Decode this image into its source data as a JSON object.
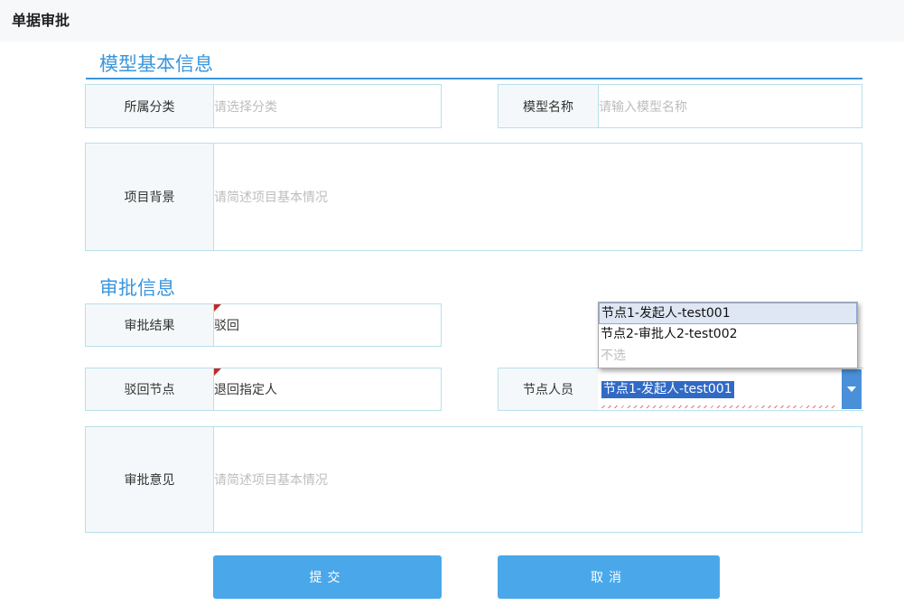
{
  "header": {
    "title": "单据审批"
  },
  "section_model": {
    "title": "模型基本信息",
    "category": {
      "label": "所属分类",
      "placeholder": "请选择分类"
    },
    "model_name": {
      "label": "模型名称",
      "placeholder": "请输入模型名称"
    },
    "background": {
      "label": "项目背景",
      "placeholder": "请简述项目基本情况"
    }
  },
  "section_approval": {
    "title": "审批信息",
    "result": {
      "label": "审批结果",
      "value": "驳回"
    },
    "reject_node": {
      "label": "驳回节点",
      "value": "退回指定人"
    },
    "node_person": {
      "label": "节点人员",
      "selected": "节点1-发起人-test001",
      "options": [
        "节点1-发起人-test001",
        "节点2-审批人2-test002",
        "不选"
      ]
    },
    "opinion": {
      "label": "审批意见",
      "placeholder": "请简述项目基本情况"
    }
  },
  "actions": {
    "submit": "提交",
    "cancel": "取消"
  },
  "colors": {
    "accent": "#3a96dd",
    "button": "#4aa8ea",
    "border": "#b9e0ea",
    "selection": "#316ac5"
  }
}
